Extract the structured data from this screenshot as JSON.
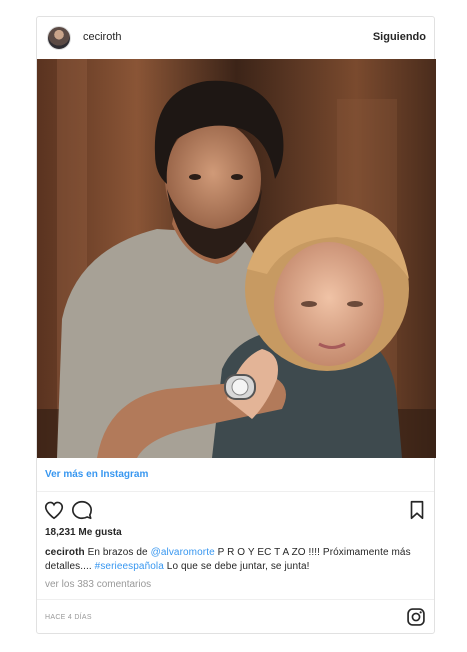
{
  "header": {
    "username": "ceciroth",
    "follow_label": "Siguiendo"
  },
  "post": {
    "view_more_label": "Ver más en Instagram",
    "likes": "18,231 Me gusta",
    "caption": {
      "username": "ceciroth",
      "text_1": " En brazos de ",
      "mention": "@alvaromorte",
      "text_2": " P R O Y EC T A ZO !!!! Próximamente más detalles.... ",
      "hashtag": "#serieespañola",
      "text_3": " Lo que se debe juntar, se junta!"
    },
    "comments_label": "ver los 383 comentarios",
    "timestamp": "HACE 4 DÍAS"
  },
  "icons": {
    "like": "heart-icon",
    "comment": "comment-icon",
    "save": "bookmark-icon",
    "instagram": "instagram-logo-icon"
  },
  "colors": {
    "link": "#3897f0",
    "text": "#262626",
    "muted": "#999999"
  }
}
